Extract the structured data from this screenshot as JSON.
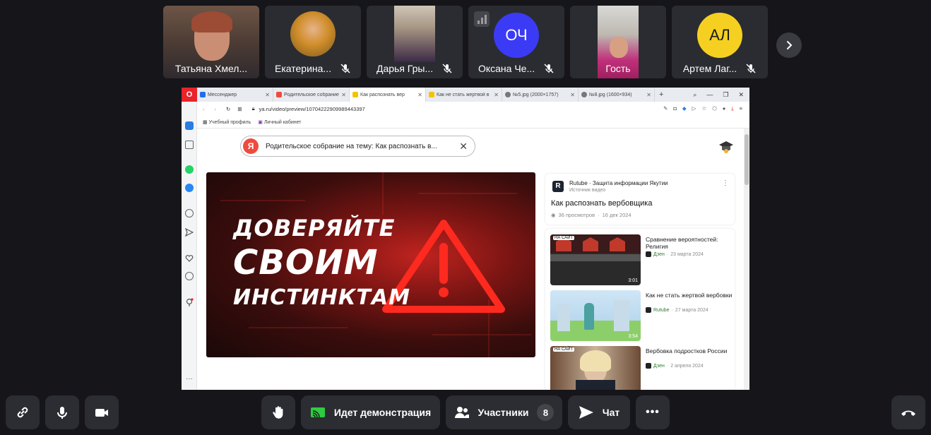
{
  "participants": [
    {
      "name": "Татьяна Хмел...",
      "muted": false,
      "initials": ""
    },
    {
      "name": "Екатерина...",
      "muted": true,
      "initials": ""
    },
    {
      "name": "Дарья Гры...",
      "muted": true,
      "initials": ""
    },
    {
      "name": "Оксана Че...",
      "muted": true,
      "initials": "ОЧ",
      "color": "#3b3bf5"
    },
    {
      "name": "Гость",
      "muted": false,
      "initials": ""
    },
    {
      "name": "Артем Лаг...",
      "muted": true,
      "initials": "АЛ",
      "color": "#f5d020"
    }
  ],
  "browser": {
    "logo": "O",
    "tabs": [
      {
        "label": "Мессенджер",
        "color": "#1e6fe8"
      },
      {
        "label": "Родительское собрание на",
        "color": "#f04a3e"
      },
      {
        "label": "Как распознать вер",
        "color": "#f5c400",
        "active": true
      },
      {
        "label": "Как не стать жертвой в",
        "color": "#f5c400"
      },
      {
        "label": "№5.jpg (2000×1757)",
        "color": "#777"
      },
      {
        "label": "№8.jpg (1600×934)",
        "color": "#777"
      }
    ],
    "new_tab": "+",
    "url": "ya.ru/video/preview/10704222909989443397",
    "bookmarks": [
      "Учебный профиль",
      "Личный кабинет"
    ],
    "search_text": "Родительское собрание на тему: Как распознать в...",
    "ya_letter": "Я"
  },
  "video": {
    "line1": "ДОВЕРЯЙТЕ",
    "line2": "СВОИМ",
    "line3": "ИНСТИНКТАМ"
  },
  "source_card": {
    "channel": "Rutube · Защита информации Якутии",
    "subtitle": "Источник видео",
    "title": "Как распознать вербовщика",
    "views": "36 просмотров",
    "date": "16 дек 2024",
    "icon_letter": "R"
  },
  "related": [
    {
      "title": "Сравнение вероятностей: Религия",
      "source": "Дзен",
      "date": "23 марта 2024",
      "duration": "3:01",
      "badge": "НА САЙТ"
    },
    {
      "title": "Как не стать жертвой вербовки",
      "source": "Rutube",
      "date": "27 марта 2024",
      "duration": "3:54",
      "badge": ""
    },
    {
      "title": "Вербовка подростков России",
      "source": "Дзен",
      "date": "2 апреля 2024",
      "duration": "",
      "badge": "НА САЙТ"
    }
  ],
  "controls": {
    "demo_label": "Идет демонстрация",
    "participants_label": "Участники",
    "participants_count": "8",
    "chat_label": "Чат",
    "more_label": "•••"
  }
}
